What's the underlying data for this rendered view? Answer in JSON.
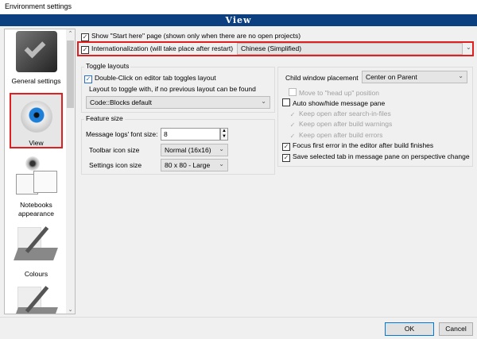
{
  "window": {
    "title": "Environment settings",
    "header": "View"
  },
  "sidebar": {
    "items": [
      {
        "label": "General settings",
        "icon": "general-settings-icon"
      },
      {
        "label": "View",
        "icon": "eye-icon",
        "selected": true
      },
      {
        "label": "Notebooks appearance",
        "icon": "notebooks-icon"
      },
      {
        "label": "Colours",
        "icon": "palette-icon"
      },
      {
        "label": "",
        "icon": "palette-icon"
      }
    ]
  },
  "main": {
    "show_start_here": {
      "label": "Show \"Start here\" page (shown only when there are no open projects)",
      "checked": true
    },
    "i18n": {
      "label": "Internationalization (will take place after restart)",
      "checked": true,
      "value": "Chinese (Simplified)"
    },
    "toggle_layouts": {
      "title": "Toggle layouts",
      "double_click": {
        "label": "Double-Click on editor tab toggles layout",
        "checked": true
      },
      "layout_label": "Layout to toggle with, if no previous layout can be found",
      "layout_value": "Code::Blocks default"
    },
    "feature_size": {
      "title": "Feature size",
      "font_size_label": "Message logs' font size:",
      "font_size_value": "8",
      "toolbar_label": "Toolbar icon size",
      "toolbar_value": "Normal (16x16)",
      "settings_label": "Settings icon size",
      "settings_value": "80 x 80 - Large"
    },
    "right": {
      "placement_label": "Child window placement",
      "placement_value": "Center on Parent",
      "head_up": {
        "label": "Move to \"head up\" position",
        "checked": false
      },
      "auto_show": {
        "label": "Auto show/hide message pane",
        "checked": false
      },
      "keep_search": {
        "label": "Keep open after search-in-files",
        "checked": true
      },
      "keep_warnings": {
        "label": "Keep open after build warnings",
        "checked": true
      },
      "keep_errors": {
        "label": "Keep open after build errors",
        "checked": true
      },
      "focus_error": {
        "label": "Focus first error in the editor after build finishes",
        "checked": true
      },
      "save_tab": {
        "label": "Save selected tab in message pane on perspective change",
        "checked": true
      }
    }
  },
  "buttons": {
    "ok": "OK",
    "cancel": "Cancel"
  }
}
